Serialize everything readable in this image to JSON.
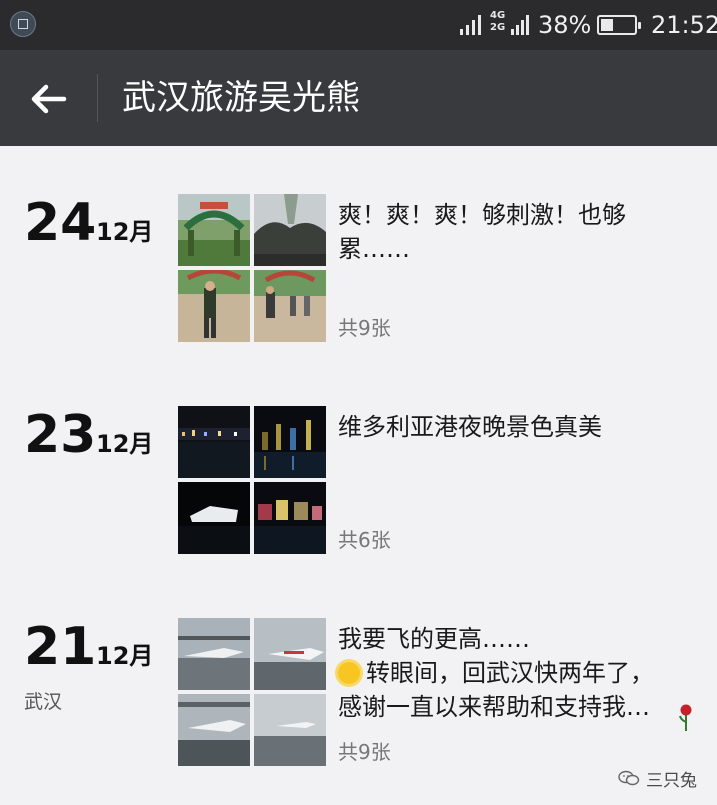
{
  "statusbar": {
    "network": "4G 2G",
    "battery_text": "38%",
    "battery_level": 0.38,
    "time": "21:52"
  },
  "header": {
    "title": "武汉旅游吴光熊",
    "back_icon": "arrow-left-icon"
  },
  "posts": [
    {
      "day": "24",
      "month": "12月",
      "location": "",
      "lines": [
        "爽！爽！爽！够刺激！也够",
        "累……"
      ],
      "count": "共9张"
    },
    {
      "day": "23",
      "month": "12月",
      "location": "",
      "lines": [
        "维多利亚港夜晚景色真美"
      ],
      "count": "共6张"
    },
    {
      "day": "21",
      "month": "12月",
      "location": "武汉",
      "lines": [
        "我要飞的更高……",
        "转眼间，回武汉快两年了，",
        "感谢一直以来帮助和支持我…"
      ],
      "count": "共9张"
    }
  ],
  "watermark": {
    "text": "三只兔",
    "icon": "wechat-icon"
  },
  "colors": {
    "statusbar_bg": "#2b2b2e",
    "header_bg": "#393a3e",
    "page_bg": "#f2f1f4"
  }
}
